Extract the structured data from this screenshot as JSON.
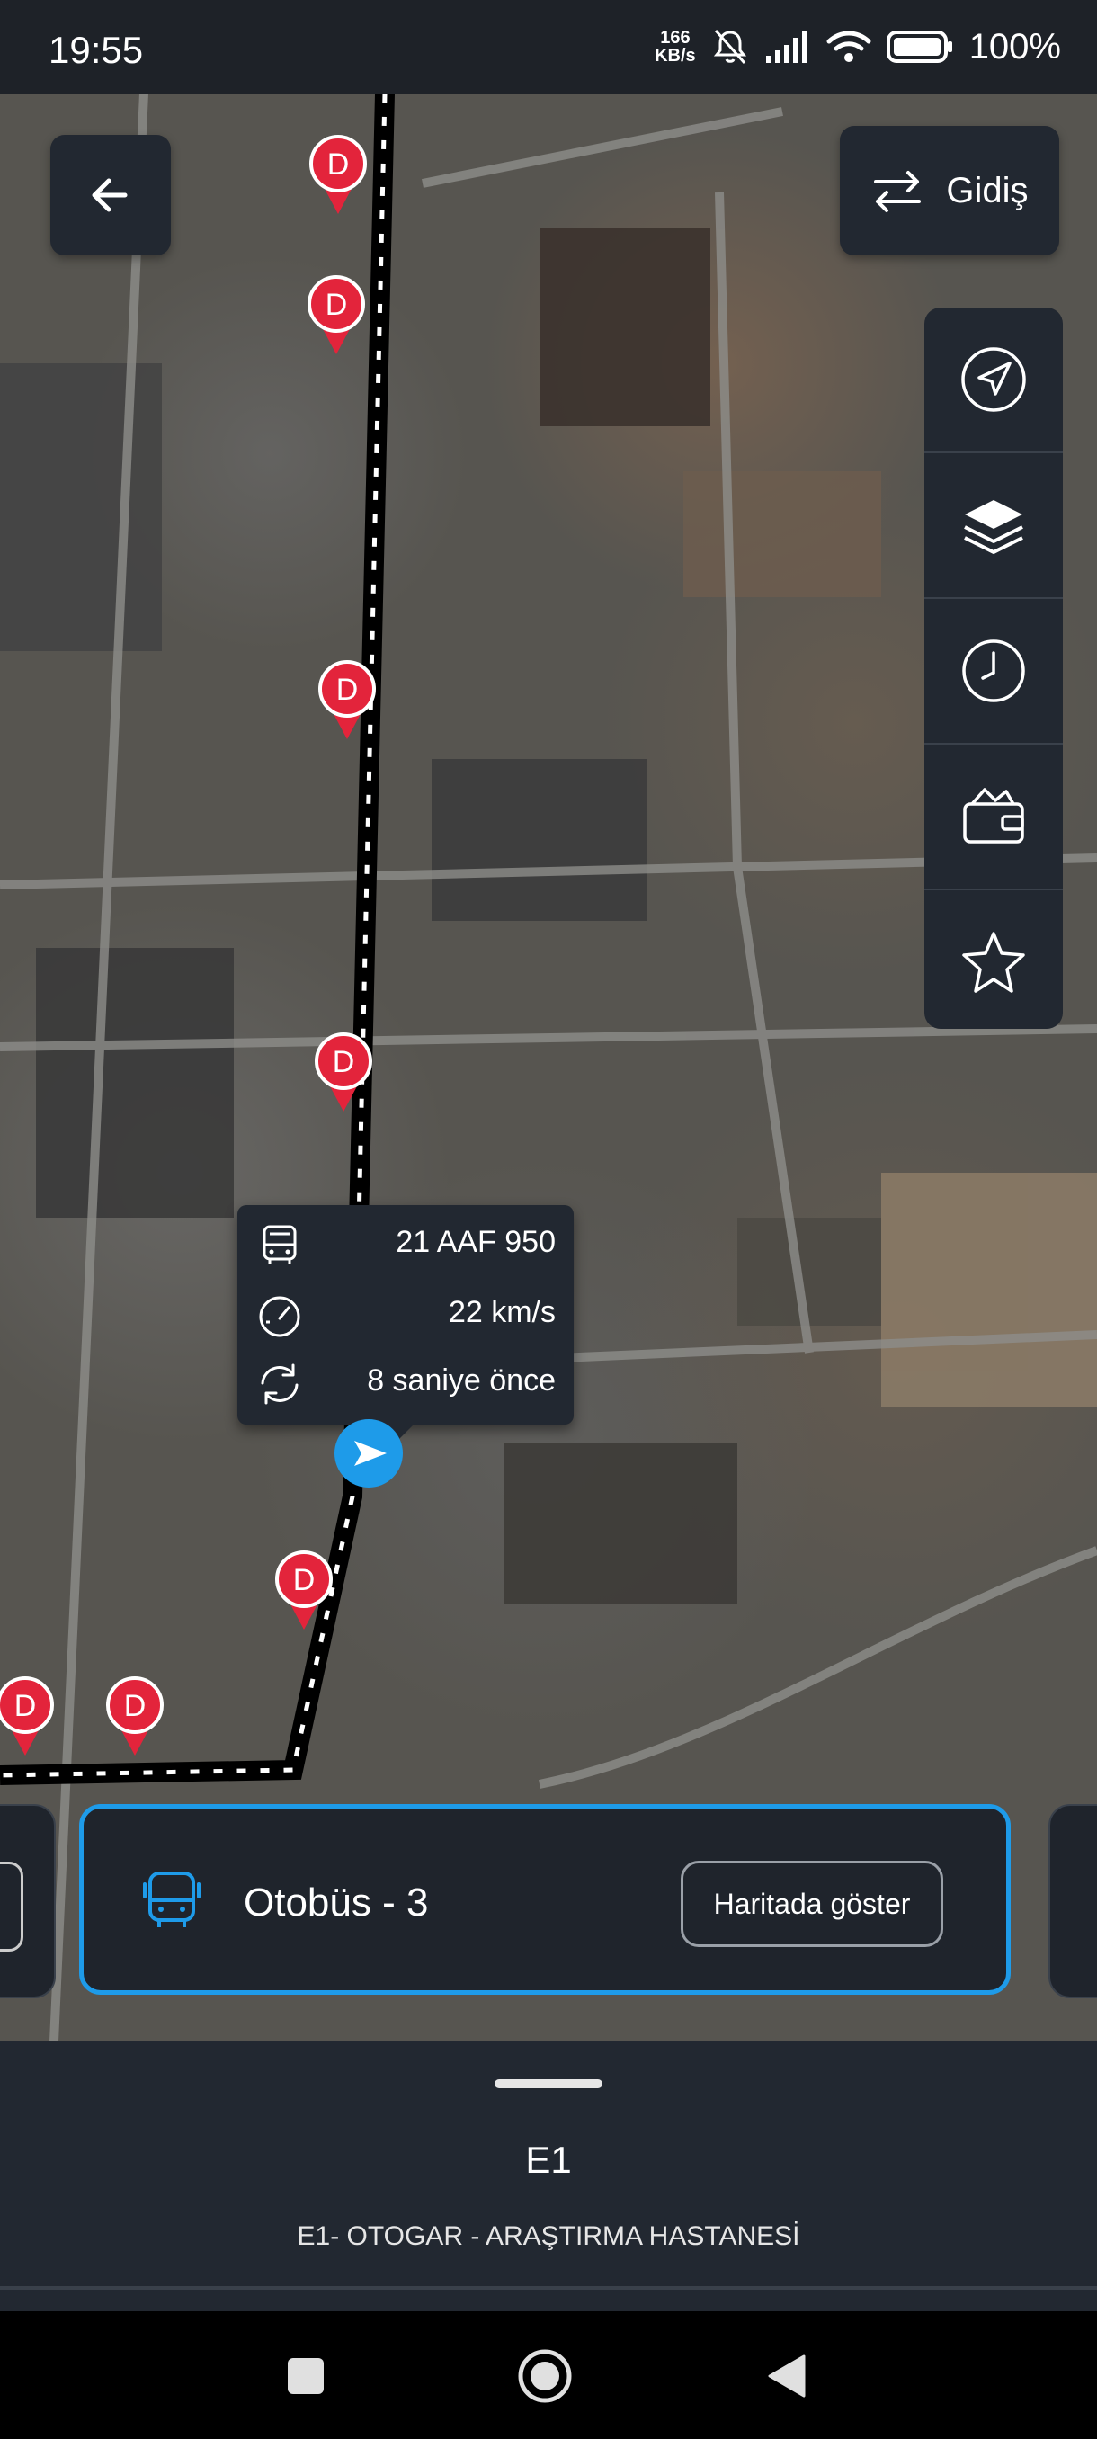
{
  "status_bar": {
    "time": "19:55",
    "net_speed_value": "166",
    "net_speed_unit": "KB/s",
    "battery": "100%",
    "icons": [
      "mute-icon",
      "signal-icon",
      "wifi-icon",
      "battery-icon"
    ]
  },
  "map": {
    "stop_marker_label": "D",
    "stop_count": 7,
    "colors": {
      "route": "#000000",
      "route_dashes": "#ffffff",
      "stop": "#e3243b",
      "bus": "#1e9be9"
    }
  },
  "top_controls": {
    "back_icon": "arrow-left-icon",
    "direction_label": "Gidiş",
    "direction_icon": "swap-arrows-icon"
  },
  "tools": [
    {
      "name": "locate",
      "icon": "navigation-arrow-icon"
    },
    {
      "name": "layers",
      "icon": "layers-icon"
    },
    {
      "name": "schedule",
      "icon": "clock-icon"
    },
    {
      "name": "wallet",
      "icon": "wallet-icon"
    },
    {
      "name": "favorite",
      "icon": "star-icon"
    }
  ],
  "vehicle_info": {
    "plate": "21 AAF 950",
    "speed": "22 km/s",
    "updated": "8 saniye önce"
  },
  "bus_card": {
    "title": "Otobüs - 3",
    "button": "Haritada göster",
    "accent": "#1e9be9"
  },
  "sheet": {
    "route_code": "E1",
    "route_name": "E1- OTOGAR - ARAŞTIRMA HASTANESİ"
  }
}
